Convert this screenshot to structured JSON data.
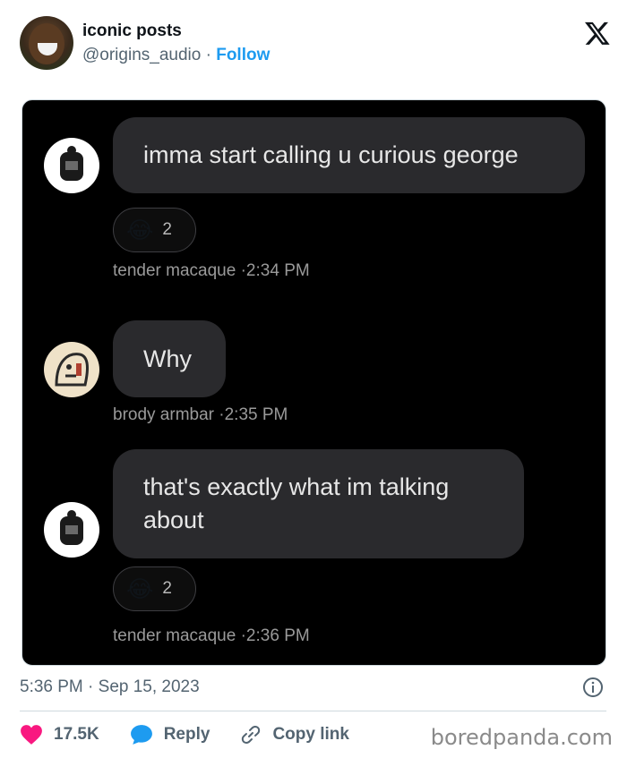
{
  "author": {
    "name": "iconic posts",
    "handle": "@origins_audio",
    "separator": "·",
    "follow_label": "Follow"
  },
  "conversation": [
    {
      "text": "imma start calling u curious george",
      "reaction": {
        "emoji": "😂",
        "count": "2"
      },
      "sender": "tender macaque",
      "time": "·2:34 PM"
    },
    {
      "text": "Why",
      "sender": "brody armbar",
      "time": "·2:35 PM"
    },
    {
      "text": "that's exactly what im talking about",
      "reaction": {
        "emoji": "😂",
        "count": "2"
      },
      "sender": "tender macaque",
      "time": "·2:36 PM"
    }
  ],
  "timestamp": "5:36 PM · Sep 15, 2023",
  "actions": {
    "like_count": "17.5K",
    "reply_label": "Reply",
    "copy_label": "Copy link"
  },
  "watermark": "boredpanda.com",
  "colors": {
    "follow": "#1d9bf0",
    "like": "#f91880",
    "reply": "#1d9bf0"
  }
}
